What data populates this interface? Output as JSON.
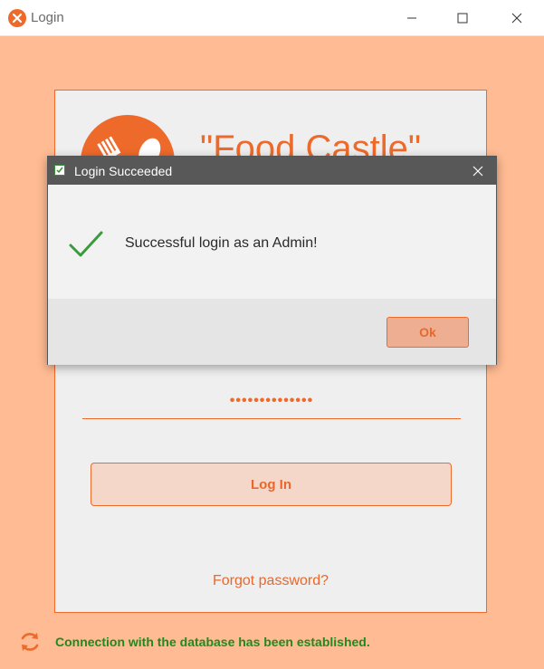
{
  "window": {
    "title": "Login",
    "icon": "app-logo-icon",
    "controls": [
      "minimize-icon",
      "maximize-icon",
      "close-icon"
    ]
  },
  "login_form": {
    "brand_text": "\"Food Castle\"",
    "password_value": "••••••••••••••",
    "login_label": "Log In",
    "forgot_label": "Forgot password?"
  },
  "status": {
    "icon": "sync-icon",
    "text": "Connection with the database has been established.",
    "color": "#1f8a1f"
  },
  "dialog": {
    "title": "Login Succeeded",
    "message": "Successful login as an Admin!",
    "ok_label": "Ok",
    "icon": "checkmark-icon"
  },
  "colors": {
    "accent": "#ee6a2a",
    "background": "#ffbb93",
    "panel": "#efefef"
  }
}
